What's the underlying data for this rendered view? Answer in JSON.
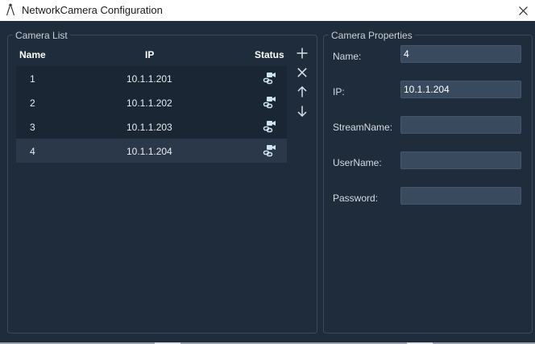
{
  "window": {
    "title": "NetworkCamera Configuration",
    "logo_icon": "app-logo-icon",
    "close_icon": "close-icon"
  },
  "camera_list": {
    "group_title": "Camera List",
    "columns": {
      "name": "Name",
      "ip": "IP",
      "status": "Status"
    },
    "rows": [
      {
        "name": "1",
        "ip": "10.1.1.201",
        "status_icon": "camera-link-icon",
        "selected": false
      },
      {
        "name": "2",
        "ip": "10.1.1.202",
        "status_icon": "camera-link-icon",
        "selected": false
      },
      {
        "name": "3",
        "ip": "10.1.1.203",
        "status_icon": "camera-link-icon",
        "selected": false
      },
      {
        "name": "4",
        "ip": "10.1.1.204",
        "status_icon": "camera-link-icon",
        "selected": true
      }
    ],
    "tools": [
      "plus-icon",
      "x-icon",
      "arrow-up-icon",
      "arrow-down-icon"
    ]
  },
  "camera_properties": {
    "group_title": "Camera Properties",
    "fields": {
      "name": {
        "label": "Name:",
        "value": "4"
      },
      "ip": {
        "label": "IP:",
        "value": "10.1.1.204"
      },
      "stream_name": {
        "label": "StreamName:",
        "value": ""
      },
      "user_name": {
        "label": "UserName:",
        "value": ""
      },
      "password": {
        "label": "Password:",
        "value": ""
      }
    }
  },
  "colors": {
    "background": "#1f2c3b",
    "row": "#1b2634",
    "row_selected": "#2a3849",
    "input": "#3a4a5e",
    "status_icon": "#cfe4f2"
  }
}
